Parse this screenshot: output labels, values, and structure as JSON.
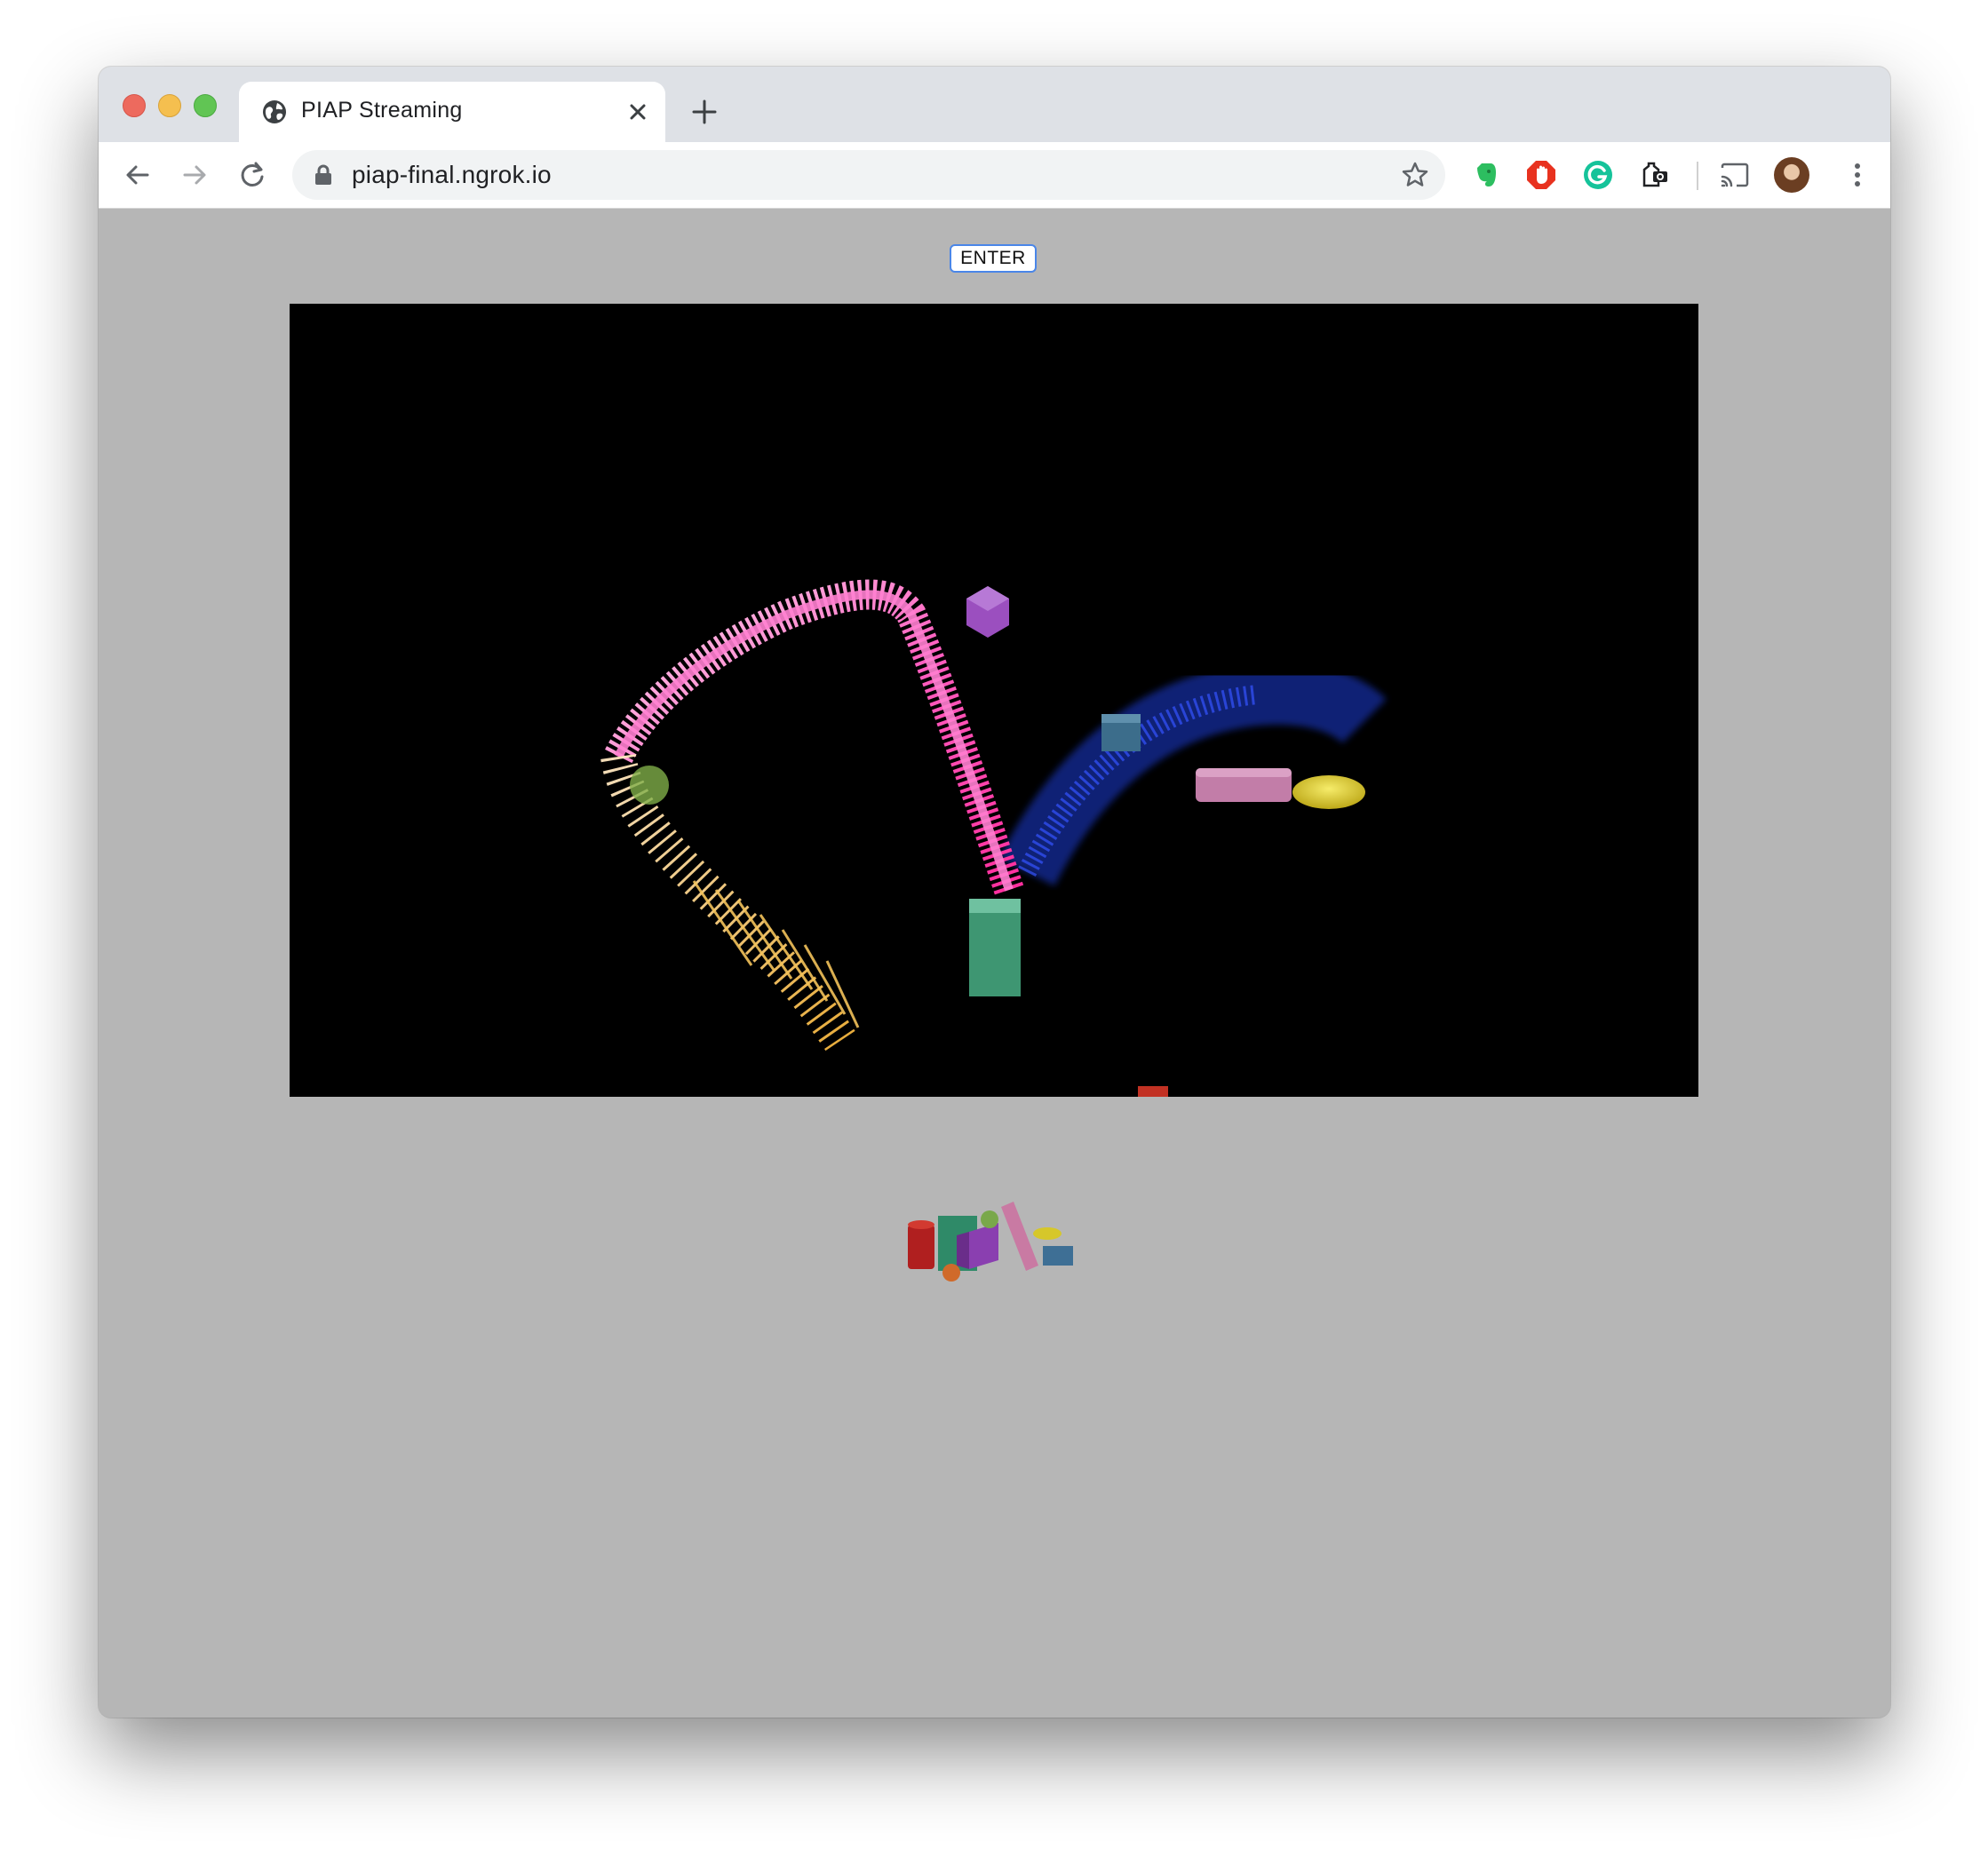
{
  "browser": {
    "tab": {
      "title": "PIAP Streaming",
      "icon": "globe-icon"
    },
    "address_bar": {
      "url": "piap-final.ngrok.io",
      "secure": true
    },
    "extensions": [
      "evernote-icon",
      "adblock-icon",
      "grammarly-icon",
      "extension-icon"
    ],
    "colors": {
      "tabstrip": "#dee1e6",
      "page_background": "#b6b6b6",
      "stage_background": "#000000"
    }
  },
  "page": {
    "enter_button_label": "ENTER",
    "stage_description": "3D scene with particle trails and geometric shapes"
  }
}
